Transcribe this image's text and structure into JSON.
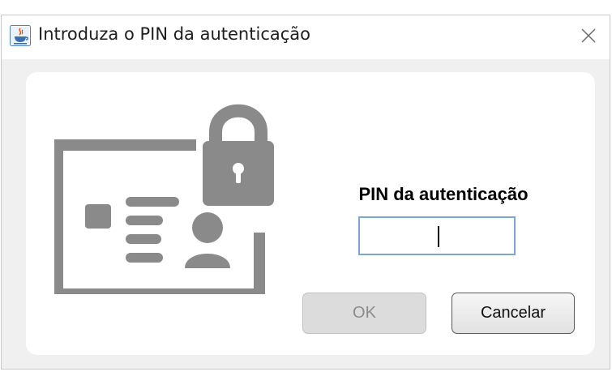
{
  "window": {
    "title": "Introduza o PIN da autenticação",
    "close_glyph": "✕"
  },
  "form": {
    "pin_label": "PIN da autenticação",
    "pin_value": "",
    "ok_label": "OK",
    "cancel_label": "Cancelar"
  },
  "icons": {
    "app": "java-cup-icon",
    "illustration": "id-card-lock-icon"
  },
  "colors": {
    "illustration_gray": "#8a8a8a",
    "input_border": "#7aa7d1",
    "panel_bg": "#ffffff",
    "window_bg": "#f0f0f0"
  }
}
